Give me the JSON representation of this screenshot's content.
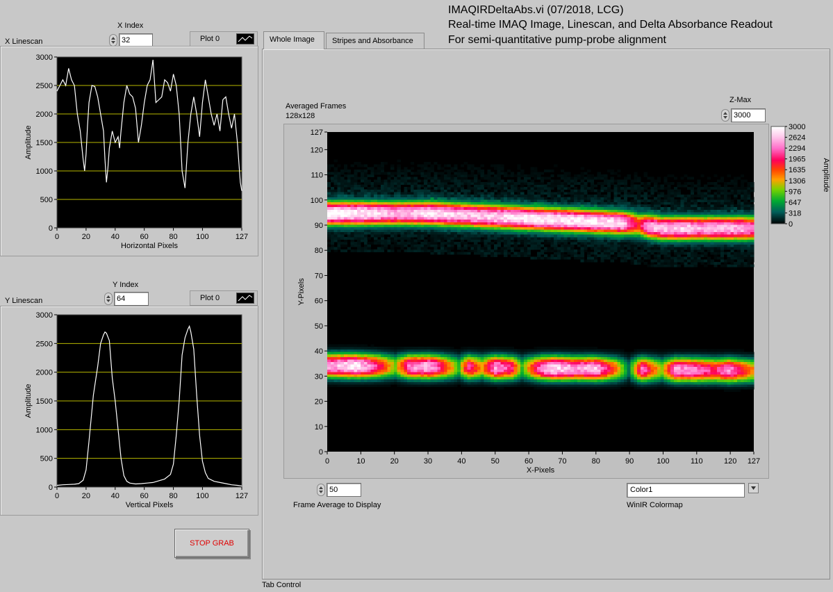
{
  "header": {
    "line1": "IMAQIRDeltaAbs.vi (07/2018, LCG)",
    "line2": "Real-time IMAQ Image, Linescan, and Delta Absorbance Readout",
    "line3": "For semi-quantitative pump-probe alignment"
  },
  "x_linescan": {
    "label": "X Linescan",
    "index_label": "X Index",
    "index_value": "32",
    "legend": "Plot 0"
  },
  "y_linescan": {
    "label": "Y Linescan",
    "index_label": "Y Index",
    "index_value": "64",
    "legend": "Plot 0"
  },
  "stop_button": "STOP GRAB",
  "tabs": [
    "Whole Image",
    "Stripes and Absorbance"
  ],
  "tab_control_label": "Tab Control",
  "intensity": {
    "title_line1": "Averaged Frames",
    "title_line2": "128x128",
    "zmax_label": "Z-Max",
    "zmax_value": "3000",
    "frame_avg_label": "Frame Average to Display",
    "frame_avg_value": "50",
    "colormap_label": "WinIR Colormap",
    "colormap_value": "Color1"
  },
  "colors": {
    "plot_bg": "#000000",
    "grid": "#b8b800",
    "trace": "#ffffff",
    "stop_text": "#e00000"
  },
  "chart_data": [
    {
      "type": "line",
      "xlabel": "Horizontal Pixels",
      "ylabel": "Amplitude",
      "xlim": [
        0,
        127
      ],
      "ylim": [
        0,
        3000
      ],
      "x_ticks": [
        "0",
        "20",
        "40",
        "60",
        "80",
        "100",
        "127"
      ],
      "y_ticks": [
        "0",
        "500",
        "1000",
        "1500",
        "2000",
        "2500",
        "3000"
      ],
      "grid": "horizontal",
      "x": [
        0,
        2,
        4,
        6,
        8,
        10,
        12,
        14,
        16,
        18,
        19,
        20,
        21,
        22,
        24,
        26,
        28,
        30,
        32,
        33,
        34,
        35,
        36,
        38,
        40,
        42,
        43,
        44,
        46,
        48,
        50,
        52,
        54,
        56,
        58,
        60,
        62,
        64,
        66,
        68,
        70,
        72,
        74,
        76,
        78,
        80,
        82,
        84,
        86,
        88,
        90,
        92,
        94,
        96,
        98,
        100,
        102,
        104,
        106,
        108,
        110,
        112,
        114,
        116,
        118,
        120,
        122,
        124,
        126,
        127
      ],
      "values": [
        2400,
        2500,
        2600,
        2500,
        2800,
        2600,
        2500,
        2000,
        1700,
        1200,
        1000,
        1300,
        1800,
        2200,
        2500,
        2480,
        2300,
        2000,
        1700,
        1200,
        800,
        1050,
        1400,
        1700,
        1500,
        1600,
        1400,
        1700,
        2200,
        2500,
        2350,
        2300,
        2100,
        1500,
        1800,
        2200,
        2500,
        2600,
        2950,
        2200,
        2250,
        2300,
        2600,
        2550,
        2400,
        2700,
        2500,
        2000,
        1000,
        700,
        1500,
        2000,
        2300,
        2000,
        1600,
        2200,
        2600,
        2300,
        2000,
        1800,
        2000,
        1700,
        2250,
        2300,
        2000,
        1750,
        2000,
        1500,
        800,
        650
      ]
    },
    {
      "type": "line",
      "xlabel": "Vertical Pixels",
      "ylabel": "Amplitude",
      "xlim": [
        0,
        127
      ],
      "ylim": [
        0,
        3000
      ],
      "x_ticks": [
        "0",
        "20",
        "40",
        "60",
        "80",
        "100",
        "127"
      ],
      "y_ticks": [
        "0",
        "500",
        "1000",
        "1500",
        "2000",
        "2500",
        "3000"
      ],
      "grid": "horizontal",
      "x": [
        0,
        4,
        8,
        12,
        15,
        18,
        20,
        22,
        25,
        28,
        30,
        32,
        33,
        34,
        36,
        38,
        40,
        42,
        44,
        46,
        48,
        50,
        54,
        58,
        62,
        66,
        70,
        74,
        78,
        80,
        82,
        84,
        86,
        88,
        90,
        91,
        92,
        94,
        96,
        98,
        100,
        102,
        104,
        108,
        112,
        116,
        120,
        124,
        127
      ],
      "values": [
        30,
        40,
        45,
        50,
        60,
        120,
        300,
        800,
        1600,
        2100,
        2500,
        2650,
        2700,
        2680,
        2550,
        1900,
        1500,
        1000,
        500,
        200,
        100,
        70,
        55,
        60,
        70,
        80,
        110,
        140,
        220,
        400,
        900,
        1500,
        2300,
        2600,
        2750,
        2800,
        2700,
        2400,
        1600,
        900,
        450,
        250,
        150,
        100,
        80,
        60,
        40,
        30,
        20
      ]
    },
    {
      "type": "heatmap",
      "xlabel": "X-Pixels",
      "ylabel": "Y-Pixels",
      "zlabel": "Amplitude",
      "xlim": [
        0,
        127
      ],
      "ylim": [
        0,
        127
      ],
      "zlim": [
        0,
        3000
      ],
      "x_ticks": [
        "0",
        "10",
        "20",
        "30",
        "40",
        "50",
        "60",
        "70",
        "80",
        "90",
        "100",
        "110",
        "120",
        "127"
      ],
      "y_ticks": [
        "0",
        "10",
        "20",
        "30",
        "40",
        "50",
        "60",
        "70",
        "80",
        "90",
        "100",
        "110",
        "120",
        "127"
      ],
      "z_ticks": [
        "0",
        "318",
        "647",
        "976",
        "1306",
        "1635",
        "1965",
        "2294",
        "2624",
        "3000"
      ],
      "upper_band": {
        "center_y": [
          [
            0,
            95
          ],
          [
            30,
            95
          ],
          [
            60,
            93
          ],
          [
            90,
            91
          ],
          [
            100,
            89
          ],
          [
            127,
            89
          ]
        ],
        "half_width": 4.5,
        "peak_amplitude": [
          [
            0,
            3000
          ],
          [
            10,
            2950
          ],
          [
            20,
            2600
          ],
          [
            25,
            2700
          ],
          [
            30,
            2900
          ],
          [
            40,
            2700
          ],
          [
            50,
            2800
          ],
          [
            60,
            2900
          ],
          [
            70,
            2950
          ],
          [
            80,
            2900
          ],
          [
            88,
            2800
          ],
          [
            93,
            1800
          ],
          [
            96,
            2600
          ],
          [
            100,
            2700
          ],
          [
            105,
            2800
          ],
          [
            112,
            2600
          ],
          [
            120,
            2700
          ],
          [
            127,
            2500
          ]
        ]
      },
      "lower_band": {
        "center_y": [
          [
            0,
            34
          ],
          [
            127,
            32
          ]
        ],
        "half_width": 4.5,
        "peak_amplitude": [
          [
            0,
            2500
          ],
          [
            8,
            2950
          ],
          [
            14,
            2200
          ],
          [
            20,
            1100
          ],
          [
            24,
            2400
          ],
          [
            30,
            2700
          ],
          [
            36,
            1600
          ],
          [
            39,
            900
          ],
          [
            42,
            2200
          ],
          [
            46,
            1400
          ],
          [
            50,
            2600
          ],
          [
            55,
            2000
          ],
          [
            58,
            900
          ],
          [
            64,
            2500
          ],
          [
            68,
            2900
          ],
          [
            74,
            2500
          ],
          [
            80,
            2700
          ],
          [
            86,
            1600
          ],
          [
            90,
            500
          ],
          [
            94,
            2400
          ],
          [
            97,
            1700
          ],
          [
            100,
            1100
          ],
          [
            104,
            2500
          ],
          [
            110,
            2400
          ],
          [
            116,
            2000
          ],
          [
            120,
            2500
          ],
          [
            124,
            1900
          ],
          [
            127,
            1500
          ]
        ]
      }
    }
  ]
}
